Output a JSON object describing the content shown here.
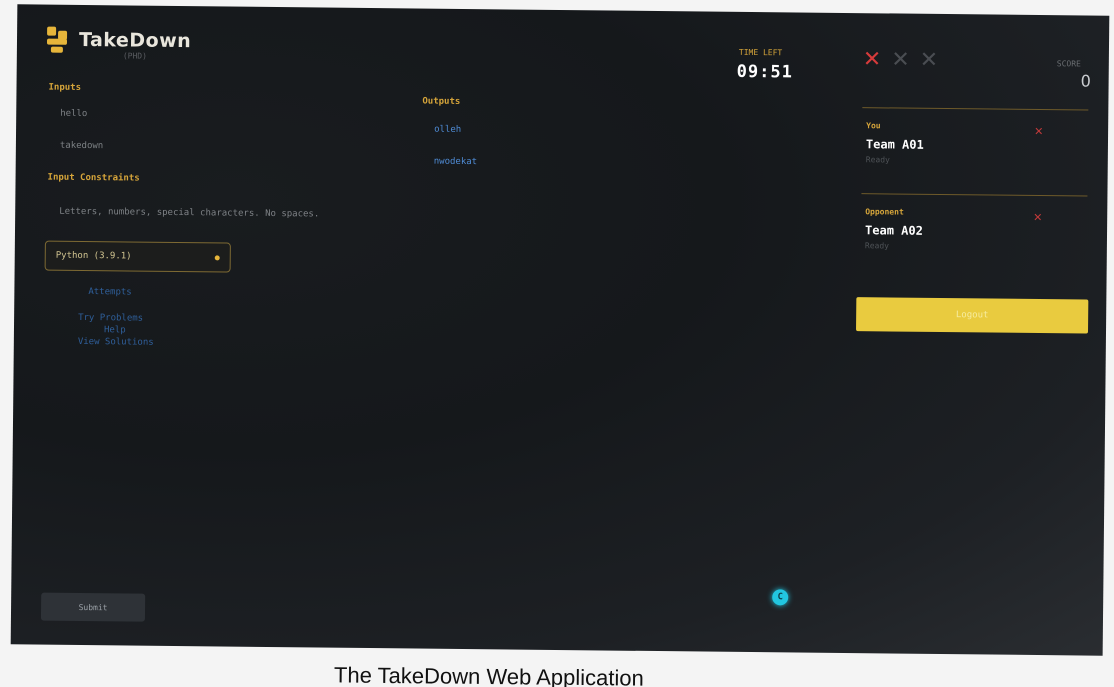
{
  "app": {
    "title": "TakeDown",
    "subtitle": "(PHD)"
  },
  "problem": {
    "inputs_label": "Inputs",
    "inputs": [
      "hello",
      "takedown"
    ],
    "outputs_label": "Outputs",
    "outputs": [
      "olleh",
      "nwodekat"
    ],
    "constraints_label": "Input Constraints",
    "constraints_text": "Letters, numbers, special characters. No spaces.",
    "language": "Python (3.9.1)",
    "links": [
      "Attempts",
      "Try Problems",
      "Help",
      "View Solutions"
    ],
    "submit_label": "Submit"
  },
  "timer": {
    "label": "TIME LEFT",
    "value": "09:51"
  },
  "strikes": [
    {
      "active": true,
      "color": "#d63b3b"
    },
    {
      "active": false,
      "color": "#4a4d52"
    },
    {
      "active": false,
      "color": "#4a4d52"
    }
  ],
  "strike_glyph": "✕",
  "score": {
    "label": "SCORE",
    "value": "0"
  },
  "teams": {
    "you": {
      "label": "You",
      "name": "Team A01",
      "sub": "Ready",
      "x": "✕"
    },
    "opponent": {
      "label": "Opponent",
      "name": "Team A02",
      "sub": "Ready",
      "x": "✕"
    }
  },
  "logout_label": "Logout",
  "cursor_letter": "C",
  "caption": "The TakeDown Web Application",
  "colors": {
    "accent": "#d6a53a",
    "logout": "#e9cb3f",
    "link": "#4f8cd6",
    "strike_active": "#d63b3b"
  }
}
